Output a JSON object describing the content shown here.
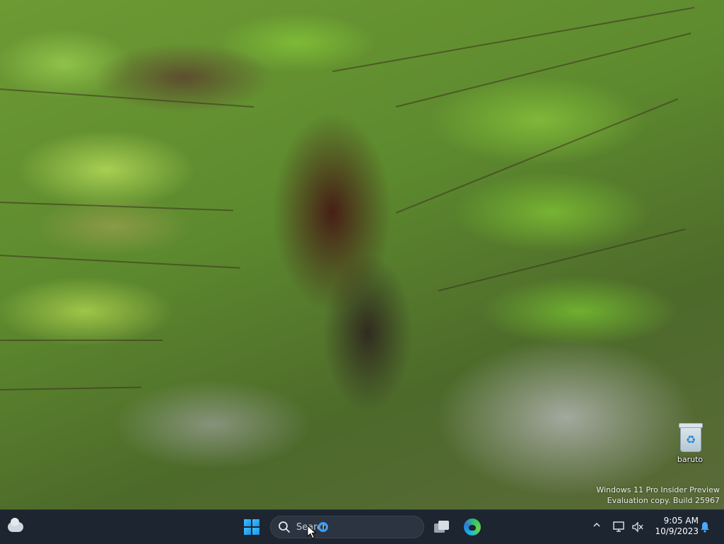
{
  "desktop": {
    "icons": [
      {
        "label": "baruto"
      }
    ],
    "watermark": {
      "line1": "Windows 11 Pro Insider Preview",
      "line2": "Evaluation copy. Build 25967"
    }
  },
  "taskbar": {
    "search_placeholder": "Search",
    "clock": {
      "time": "9:05 AM",
      "date": "10/9/2023"
    },
    "tray_overflow_glyph": "^"
  },
  "colors": {
    "taskbar_bg": "#1c2530",
    "accent": "#3aa0ff"
  },
  "icons": {
    "weather": "weather-cloud-icon",
    "start": "windows-logo-icon",
    "search": "search-icon",
    "task_view": "task-view-icon",
    "edge": "edge-browser-icon",
    "network": "network-icon",
    "volume": "volume-muted-icon",
    "notification": "bell-icon",
    "recycle_bin": "recycle-bin-icon"
  }
}
